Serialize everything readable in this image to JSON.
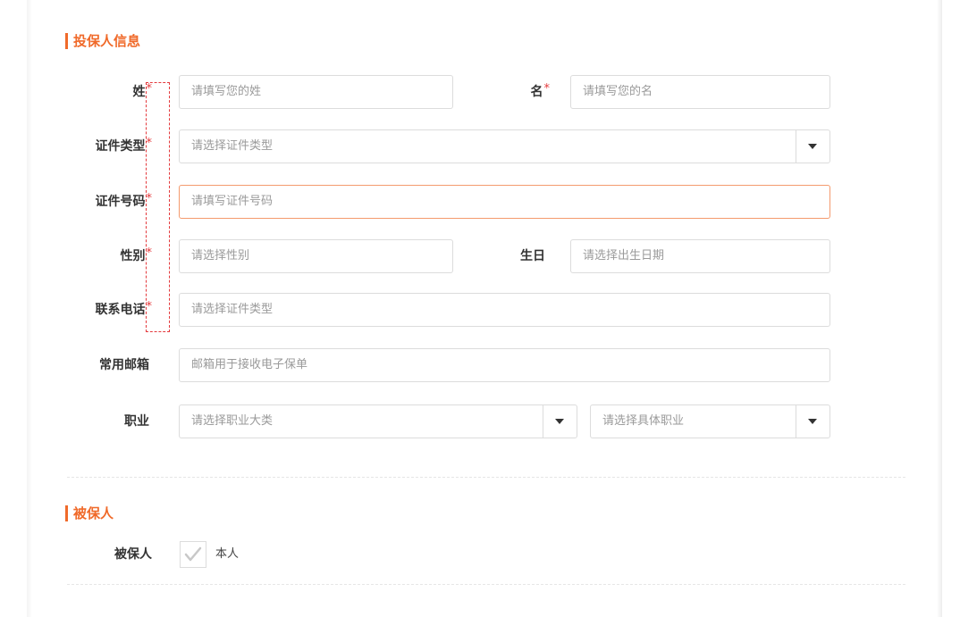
{
  "applicant_section": {
    "title": "投保人信息",
    "fields": {
      "surname": {
        "label": "姓",
        "placeholder": "请填写您的姓"
      },
      "given_name": {
        "label": "名",
        "placeholder": "请填写您的名"
      },
      "id_type": {
        "label": "证件类型",
        "placeholder": "请选择证件类型"
      },
      "id_number": {
        "label": "证件号码",
        "placeholder": "请填写证件号码"
      },
      "gender": {
        "label": "性别",
        "placeholder": "请选择性别"
      },
      "birthday": {
        "label": "生日",
        "placeholder": "请选择出生日期"
      },
      "phone": {
        "label": "联系电话",
        "placeholder": "请选择证件类型"
      },
      "email": {
        "label": "常用邮箱",
        "placeholder": "邮箱用于接收电子保单"
      },
      "occupation": {
        "label": "职业",
        "placeholder_category": "请选择职业大类",
        "placeholder_specific": "请选择具体职业"
      }
    },
    "required_mark": "*"
  },
  "insured_section": {
    "title": "被保人",
    "label": "被保人",
    "option_self": "本人"
  },
  "icons": {
    "dropdown": "caret-down-icon",
    "check": "check-icon"
  },
  "colors": {
    "accent": "#f06a2a",
    "required": "#e4393c",
    "border": "#dcdcdc",
    "focus_border": "#f49a6e",
    "placeholder": "#9a9a9a"
  }
}
